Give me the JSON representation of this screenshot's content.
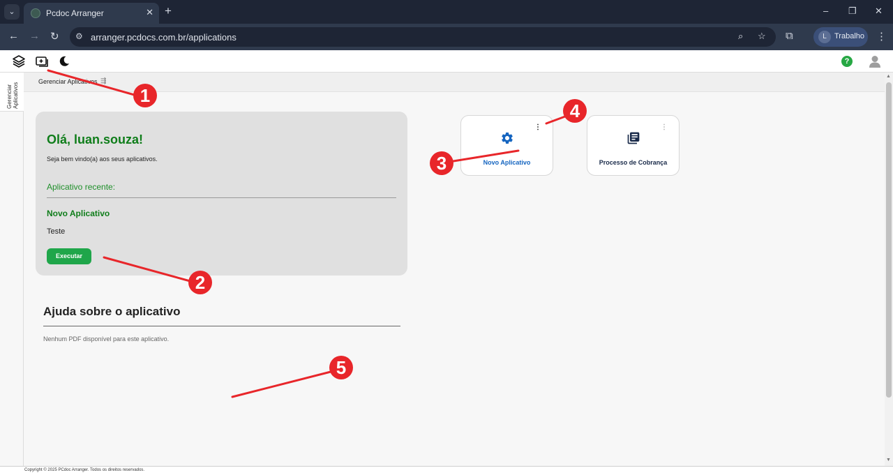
{
  "browser": {
    "tab_title": "Pcdoc Arranger",
    "tab_close": "✕",
    "new_tab": "+",
    "url": "arranger.pcdocs.com.br/applications",
    "profile_initial": "L",
    "profile_name": "Trabalho",
    "window_controls": [
      "–",
      "❐",
      "✕"
    ]
  },
  "header": {
    "help_label": "?"
  },
  "sidebar": {
    "tab_label_line1": "Gerenciar",
    "tab_label_line2": "Aplicativos"
  },
  "breadcrumb": {
    "label": "Gerenciar Aplicativos",
    "icon": "⇶"
  },
  "welcome": {
    "greeting": "Olá, luan.souza!",
    "subtitle": "Seja bem vindo(a) aos seus aplicativos.",
    "recent_label": "Aplicativo recente:",
    "recent_app_name": "Novo Aplicativo",
    "recent_app_desc": "Teste",
    "run_button": "Executar"
  },
  "help": {
    "title": "Ajuda sobre o aplicativo",
    "text": "Nenhum PDF disponível para este aplicativo."
  },
  "apps": [
    {
      "label": "Novo Aplicativo",
      "icon": "gear-icon",
      "color": "#1565c0"
    },
    {
      "label": "Processo de Cobrança",
      "icon": "library-books-icon",
      "color": "#1a2b4a"
    }
  ],
  "footer": {
    "copyright": "Copyright © 2025 PCdoc Arranger. Todos os direitos reservados."
  },
  "annotations": {
    "color": "#e8262a",
    "markers": [
      "1",
      "2",
      "3",
      "4",
      "5"
    ]
  }
}
